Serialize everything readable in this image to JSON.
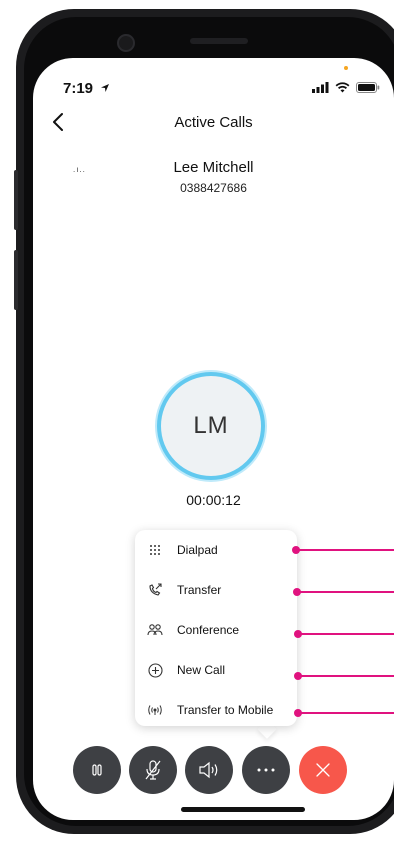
{
  "status_bar": {
    "time": "7:19"
  },
  "header": {
    "title": "Active Calls"
  },
  "caller": {
    "name": "Lee Mitchell",
    "number": "0388427686",
    "initials": "LM"
  },
  "call": {
    "duration": "00:00:12"
  },
  "menu": {
    "items": [
      {
        "label": "Dialpad",
        "icon": "dialpad-icon"
      },
      {
        "label": "Transfer",
        "icon": "transfer-icon"
      },
      {
        "label": "Conference",
        "icon": "conference-icon"
      },
      {
        "label": "New Call",
        "icon": "new-call-icon"
      },
      {
        "label": "Transfer to Mobile",
        "icon": "transfer-to-mobile-icon"
      }
    ]
  },
  "controls": [
    {
      "name": "hold",
      "icon": "pause-icon"
    },
    {
      "name": "mute",
      "icon": "mic-off-icon"
    },
    {
      "name": "speaker",
      "icon": "speaker-icon"
    },
    {
      "name": "more",
      "icon": "more-icon"
    },
    {
      "name": "end-call",
      "icon": "end-call-icon"
    }
  ],
  "colors": {
    "accent_ring": "#62c9ef",
    "end_call": "#f7574b",
    "control_bg": "#3e4044",
    "callout": "#e0127f"
  }
}
